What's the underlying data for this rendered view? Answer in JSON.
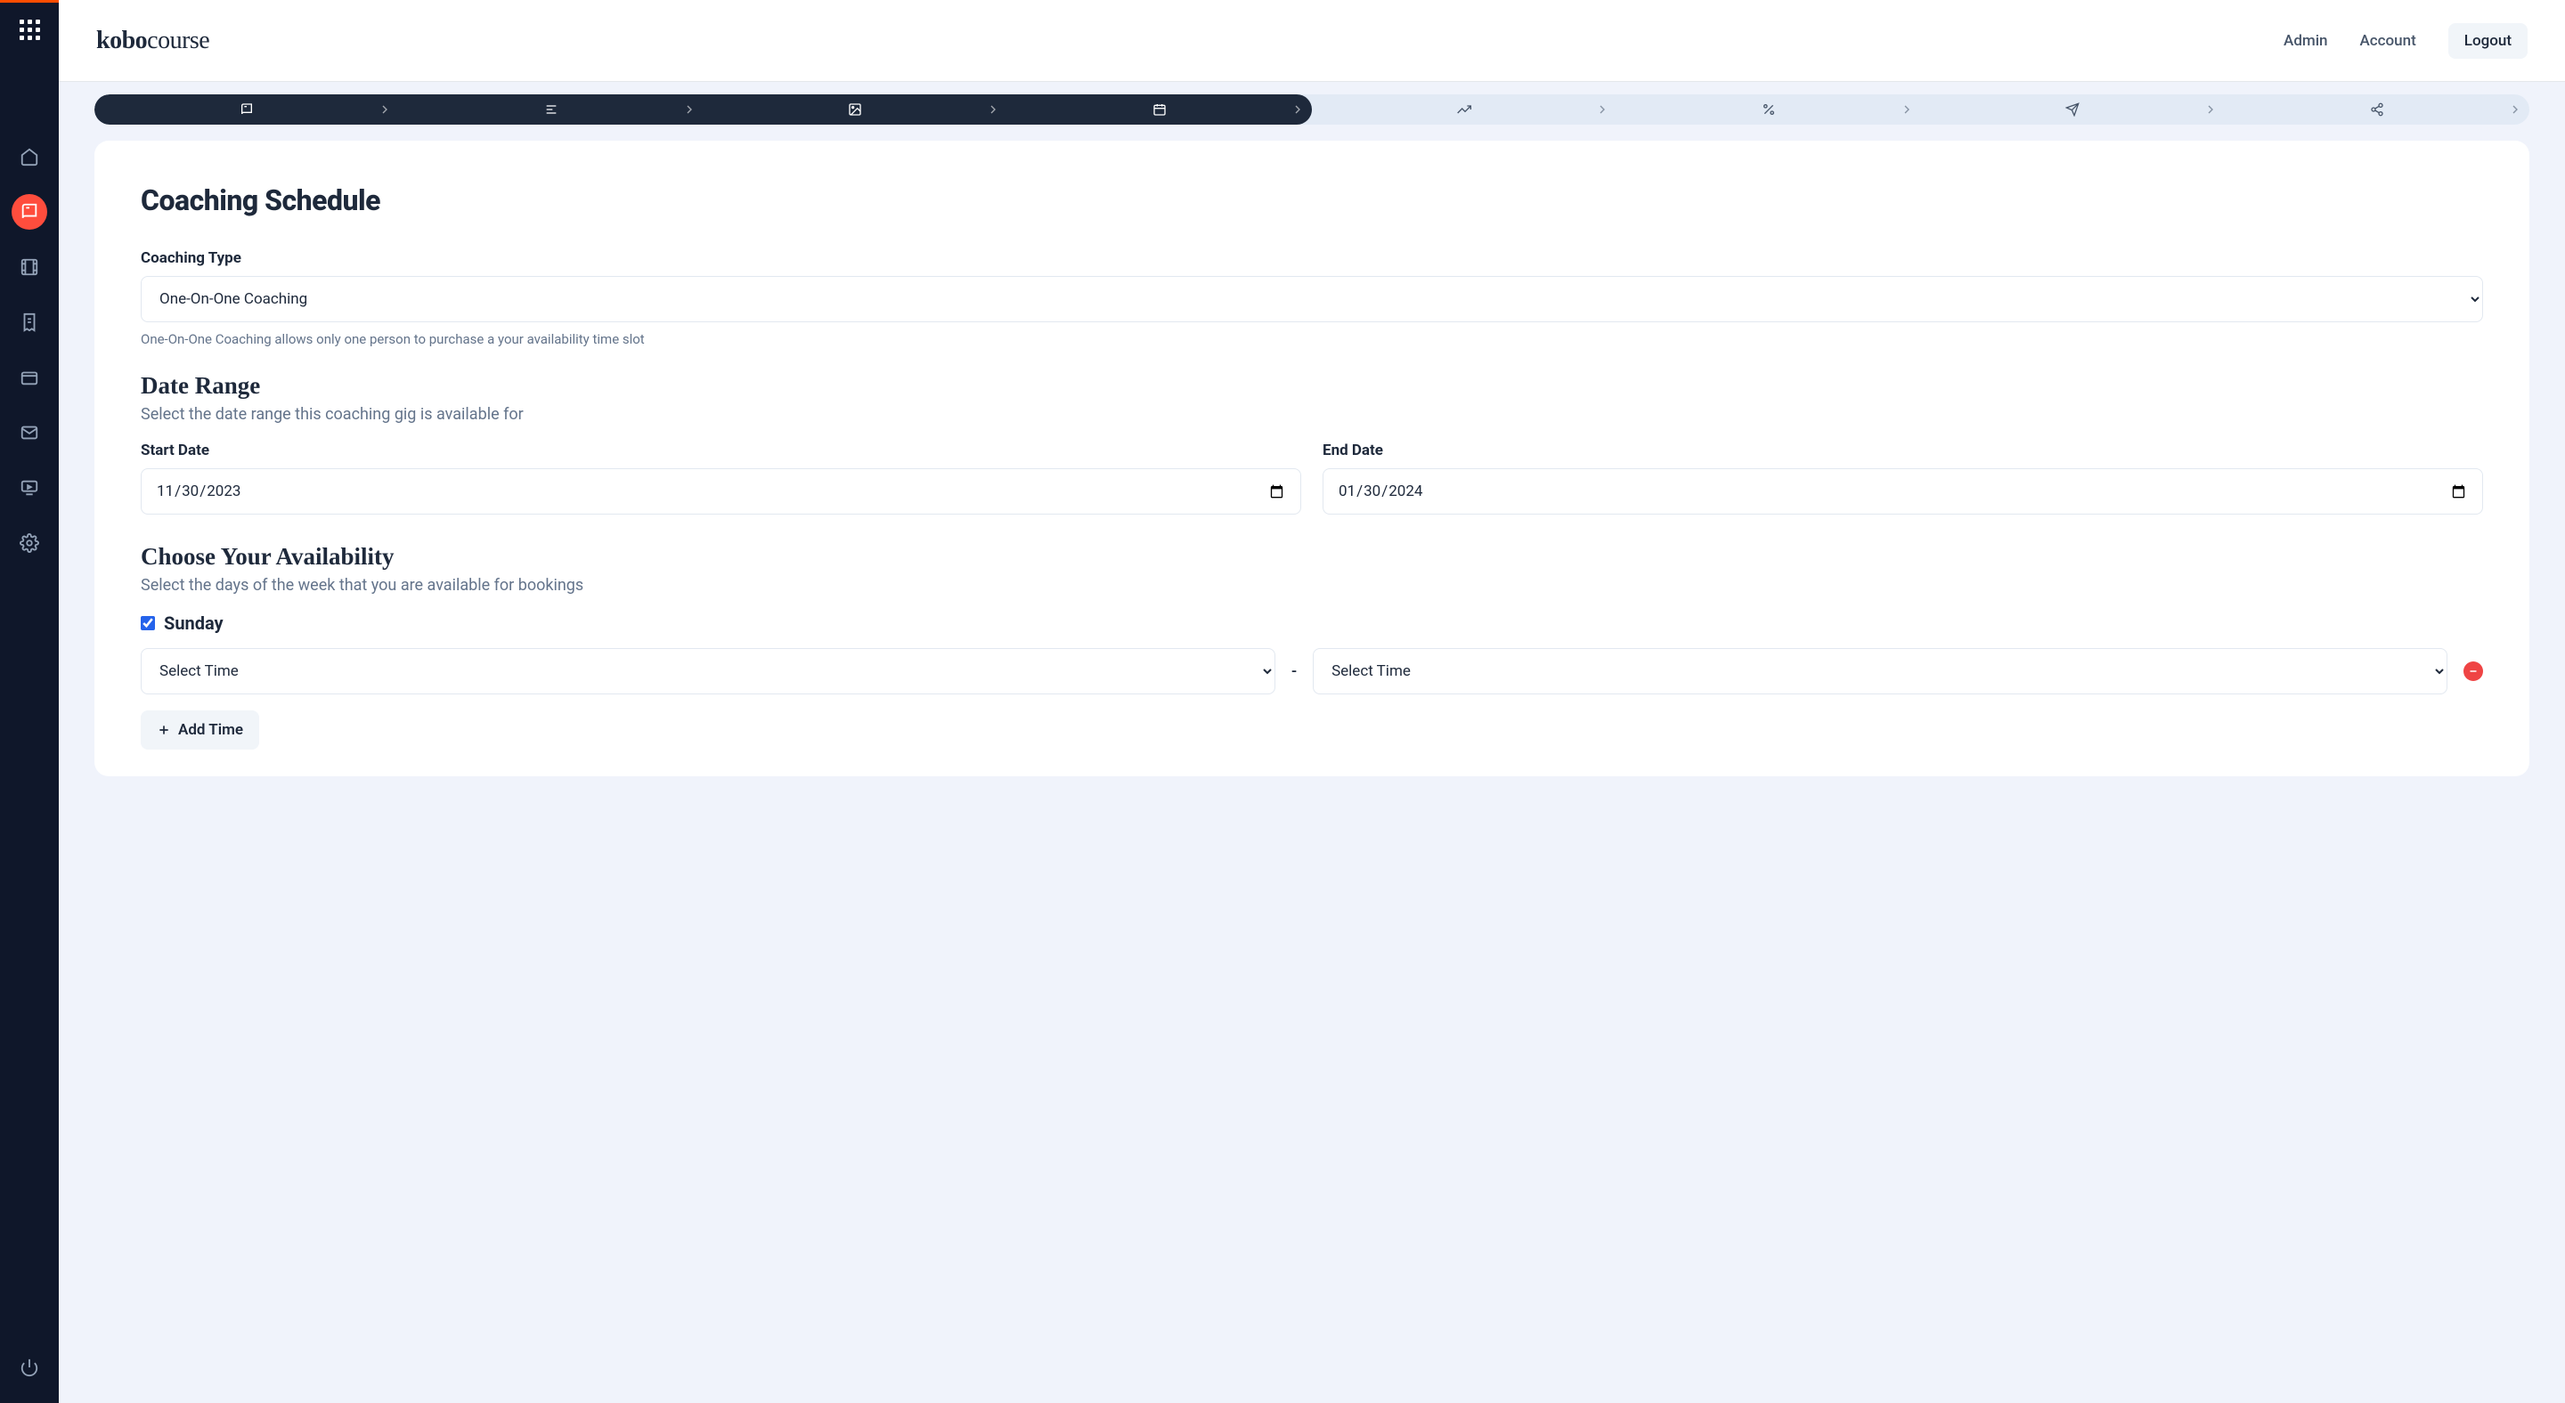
{
  "logo": {
    "bold": "kobo",
    "rest": "course"
  },
  "topnav": {
    "admin": "Admin",
    "account": "Account",
    "logout": "Logout"
  },
  "page": {
    "title": "Coaching Schedule",
    "coaching_type_label": "Coaching Type",
    "coaching_type_value": "One-On-One Coaching",
    "coaching_type_help": "One-On-One Coaching allows only one person to purchase a your availability time slot",
    "date_range_heading": "Date Range",
    "date_range_sub": "Select the date range this coaching gig is available for",
    "start_date_label": "Start Date",
    "start_date_value": "2023-11-30",
    "end_date_label": "End Date",
    "end_date_value": "2024-01-30",
    "availability_heading": "Choose Your Availability",
    "availability_sub": "Select the days of the week that you are available for bookings",
    "day": {
      "name": "Sunday",
      "checked": true
    },
    "time_placeholder": "Select Time",
    "time_sep": "-",
    "add_time_label": "Add Time"
  }
}
